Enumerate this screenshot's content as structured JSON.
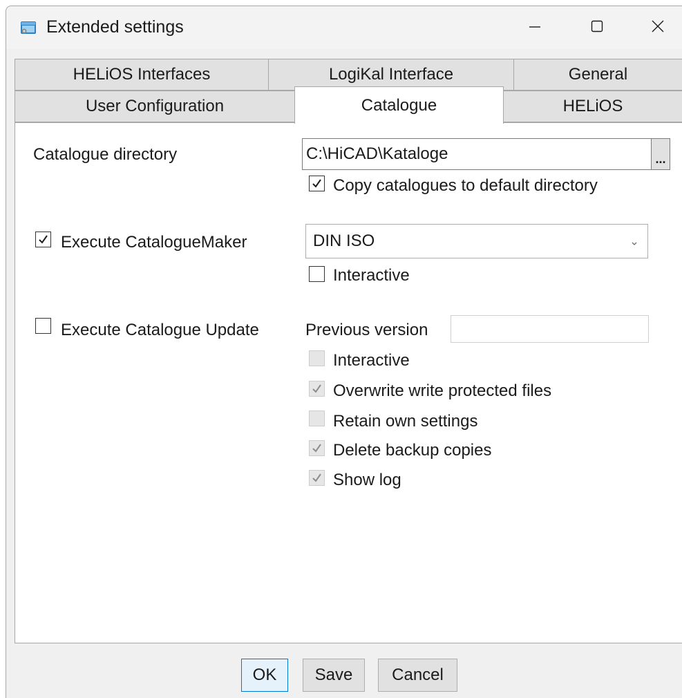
{
  "window": {
    "title": "Extended settings",
    "controls": {
      "minimize": "minimize",
      "maximize": "maximize",
      "close": "close"
    }
  },
  "tabs": {
    "row_back": [
      "HELiOS Interfaces",
      "LogiKal Interface",
      "General"
    ],
    "row_front": [
      "User Configuration",
      "Catalogue",
      "HELiOS"
    ],
    "active": "Catalogue"
  },
  "catalogue": {
    "directory_label": "Catalogue directory",
    "directory_value": "C:\\HiCAD\\Kataloge",
    "browse_label": "...",
    "copy_label": "Copy catalogues to default directory",
    "copy_checked": true,
    "maker_label": "Execute CatalogueMaker",
    "maker_checked": true,
    "maker_standard": "DIN ISO",
    "maker_interactive_label": "Interactive",
    "maker_interactive_checked": false,
    "update_label": "Execute Catalogue Update",
    "update_checked": false,
    "previous_version_label": "Previous version",
    "previous_version_value": "",
    "update_options": [
      {
        "label": "Interactive",
        "checked": false
      },
      {
        "label": "Overwrite write protected files",
        "checked": true
      },
      {
        "label": "Retain own settings",
        "checked": false
      },
      {
        "label": "Delete backup copies",
        "checked": true
      },
      {
        "label": "Show log",
        "checked": true
      }
    ]
  },
  "footer": {
    "ok": "OK",
    "save": "Save",
    "cancel": "Cancel"
  },
  "colors": {
    "window_bg": "#f0f0f0",
    "tab_bg": "#e1e1e1",
    "border": "#a7a7a7",
    "default_button_border": "#0078d4",
    "disabled_check": "#8c8c8c"
  },
  "icons": {
    "app": "app-window-icon",
    "minimize": "minimize-icon",
    "maximize": "maximize-icon",
    "close": "close-icon",
    "check": "checkmark-icon",
    "dropdown": "chevron-down-icon"
  }
}
